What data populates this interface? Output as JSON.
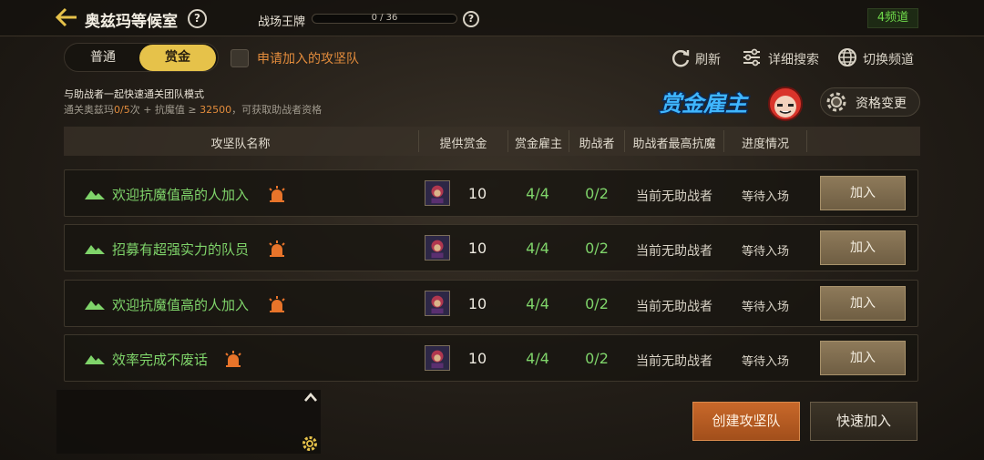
{
  "header": {
    "room_title": "奥兹玛等候室",
    "battlefield_label": "战场王牌",
    "battlefield_progress": "0 / 36",
    "battlefield_progress_fraction": 0,
    "help_glyph": "?",
    "channel": "4频道"
  },
  "tabs": [
    {
      "label": "普通",
      "selected": false
    },
    {
      "label": "赏金",
      "selected": true
    }
  ],
  "apply_label": "申请加入的攻坚队",
  "toolbar": {
    "refresh": "刷新",
    "detail_search": "详细搜索",
    "switch_channel": "切换频道"
  },
  "desc": {
    "line1": "与助战者一起快速通关团队模式",
    "line2_a": "通关奥兹玛",
    "line2_b": "0/5",
    "line2_c": "次 + 抗魔值 ≥ ",
    "line2_d": "32500",
    "line2_e": "，可获取助战者资格"
  },
  "bounty_logo": "赏金雇主",
  "qualification_button": "资格变更",
  "columns": [
    "攻坚队名称",
    "提供赏金",
    "赏金雇主",
    "助战者",
    "助战者最高抗魔",
    "进度情况"
  ],
  "rows": [
    {
      "name": "欢迎抗魔值高的人加入",
      "bounty": "10",
      "employers": "4/4",
      "helpers": "0/2",
      "max_resist": "当前无助战者",
      "status": "等待入场",
      "action": "加入"
    },
    {
      "name": "招募有超强实力的队员",
      "bounty": "10",
      "employers": "4/4",
      "helpers": "0/2",
      "max_resist": "当前无助战者",
      "status": "等待入场",
      "action": "加入"
    },
    {
      "name": "欢迎抗魔值高的人加入",
      "bounty": "10",
      "employers": "4/4",
      "helpers": "0/2",
      "max_resist": "当前无助战者",
      "status": "等待入场",
      "action": "加入"
    },
    {
      "name": "效率完成不废话",
      "bounty": "10",
      "employers": "4/4",
      "helpers": "0/2",
      "max_resist": "当前无助战者",
      "status": "等待入场",
      "action": "加入"
    }
  ],
  "buttons": {
    "create": "创建攻坚队",
    "quick_join": "快速加入"
  },
  "colors": {
    "accent_gold": "#e6c24a",
    "orange": "#e38c3c",
    "green": "#7fd46a"
  }
}
